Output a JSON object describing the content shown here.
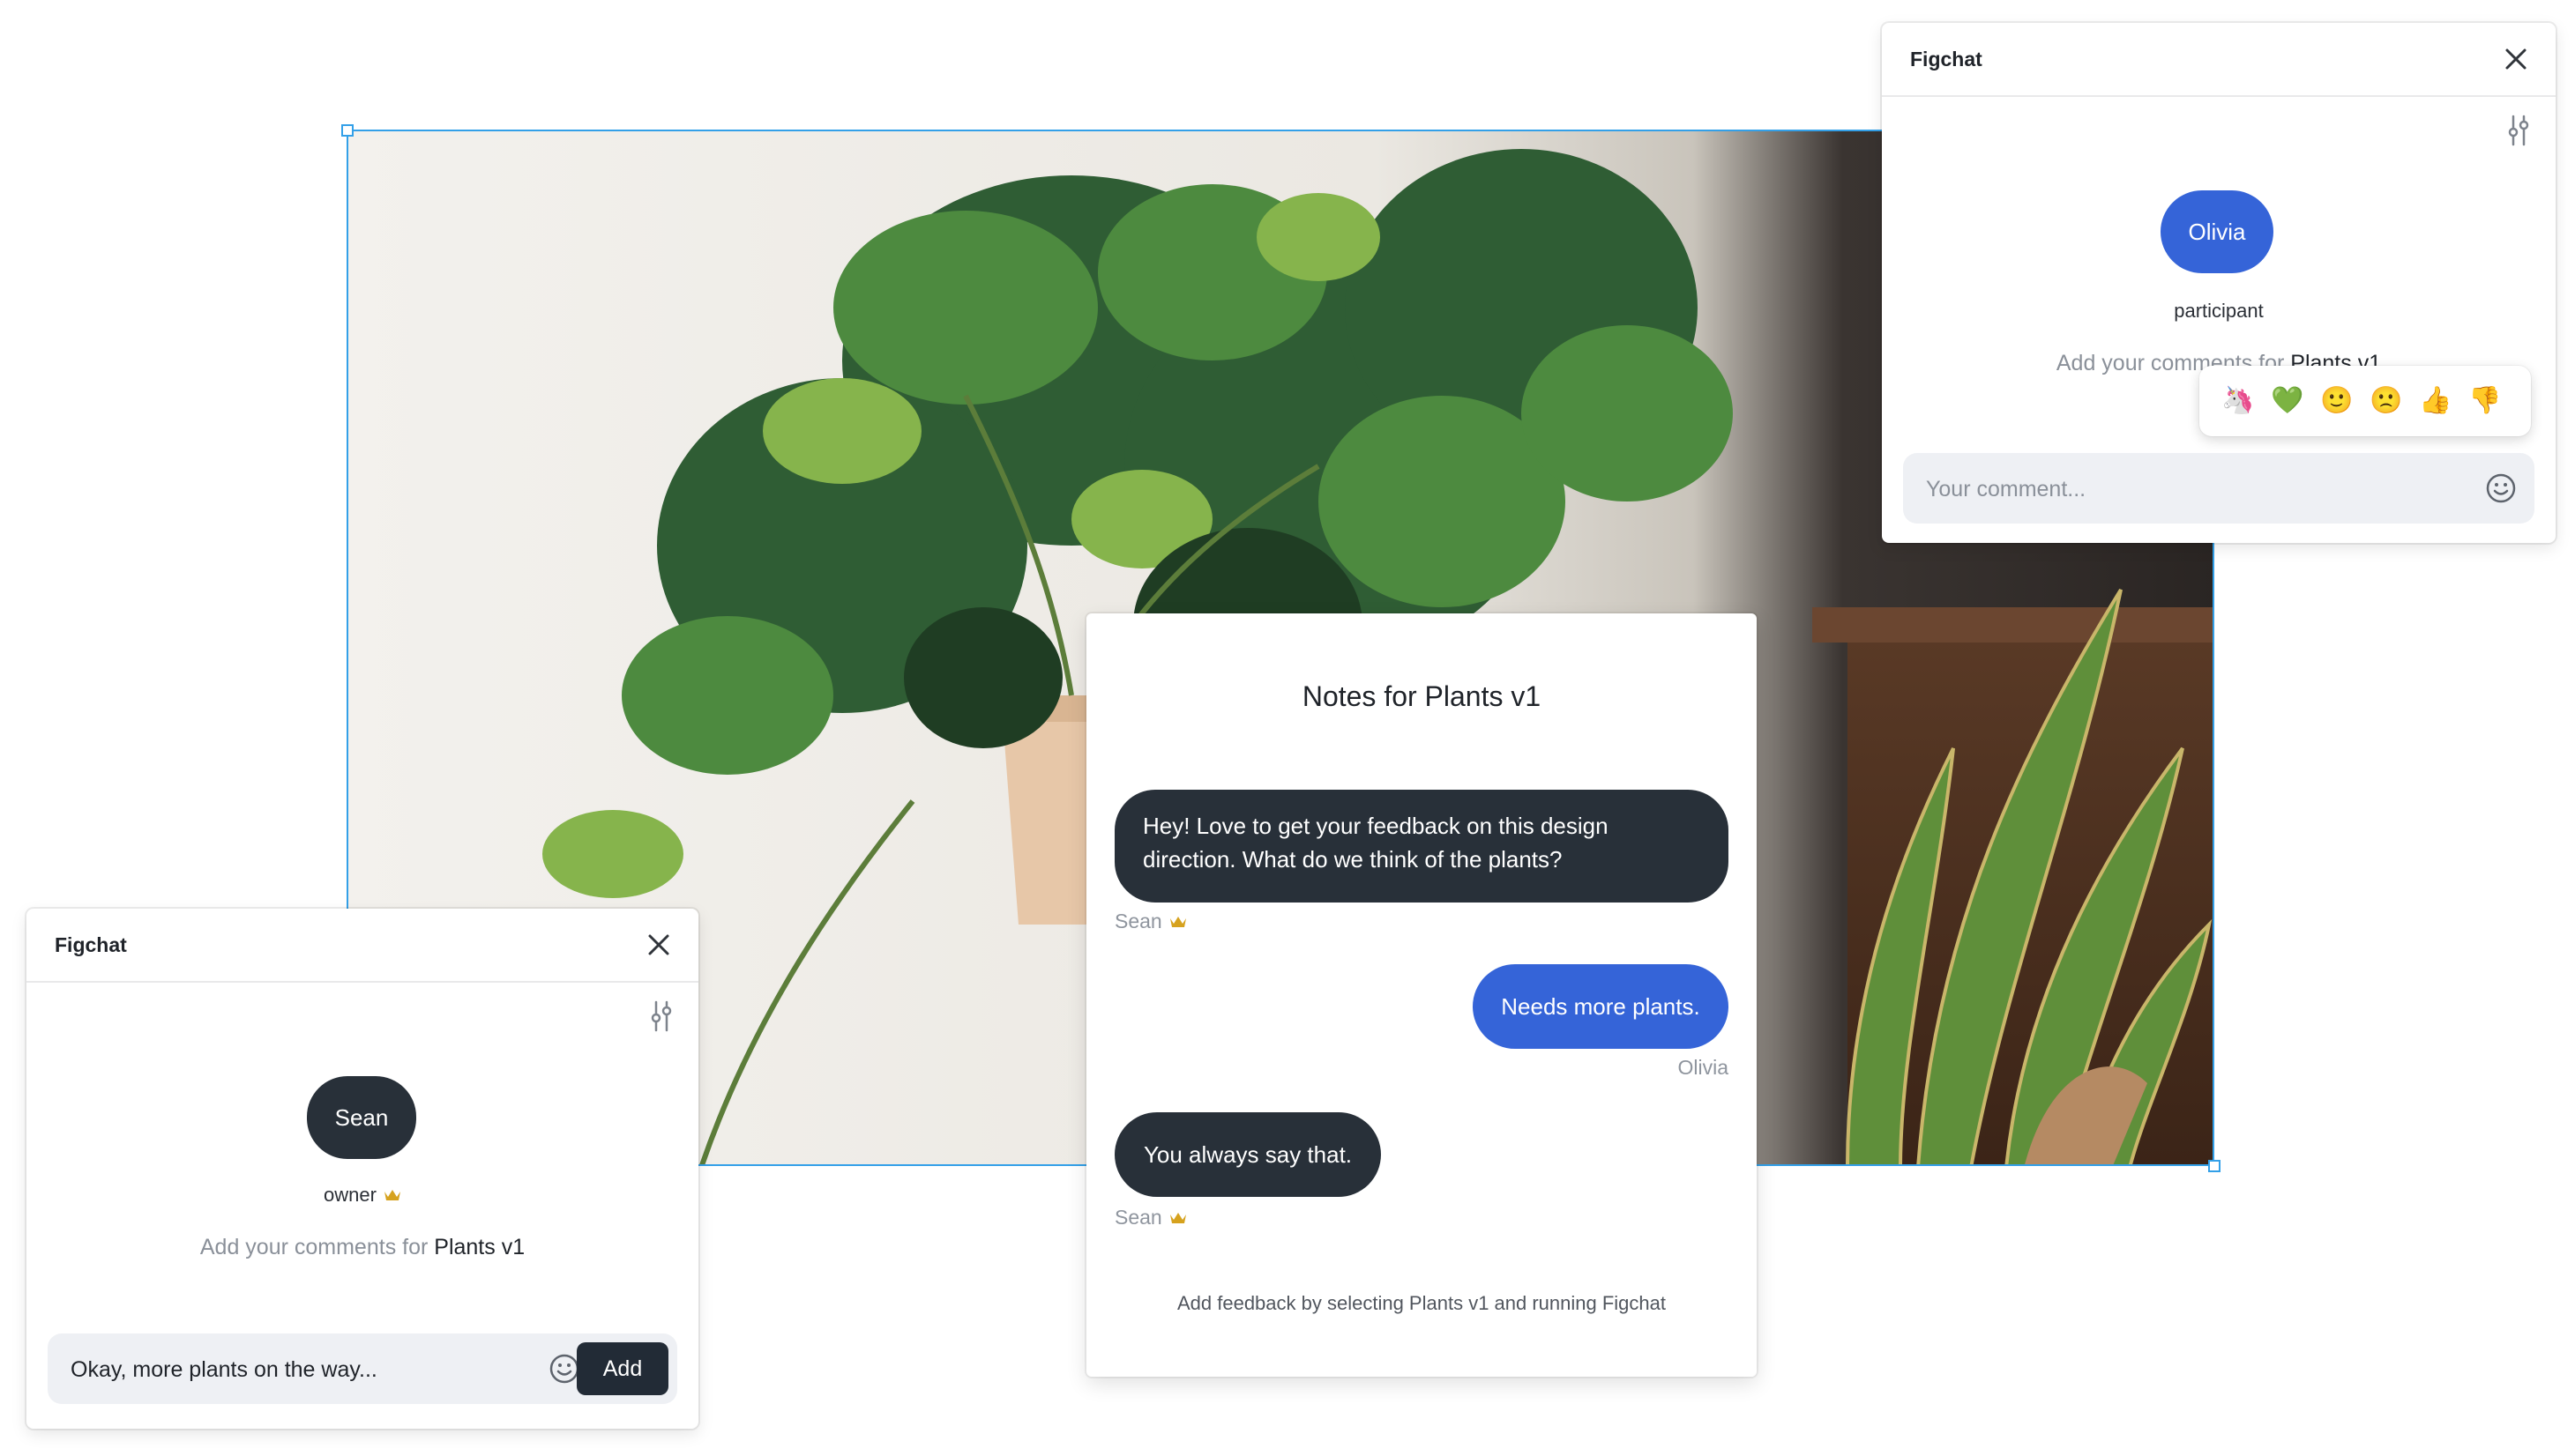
{
  "colors": {
    "selection": "#33a0e8",
    "dark_bubble": "#283039",
    "blue_bubble": "#3564d8",
    "add_button": "#222b36"
  },
  "top_right_window": {
    "title": "Figchat",
    "close_icon": "close-icon",
    "settings_icon": "sliders-icon",
    "avatar_name": "Olivia",
    "role": "participant",
    "hint_prefix": "Add your comments for",
    "hint_target": "Plants v1",
    "input_placeholder": "Your comment...",
    "emoji_icon": "smiley-icon"
  },
  "reactions": [
    "🦄",
    "💚",
    "🙂",
    "🙁",
    "👍",
    "👎"
  ],
  "bottom_left_window": {
    "title": "Figchat",
    "close_icon": "close-icon",
    "settings_icon": "sliders-icon",
    "avatar_name": "Sean",
    "role": "owner",
    "role_badge_icon": "crown-icon",
    "hint_prefix": "Add your comments for",
    "hint_target": "Plants v1",
    "input_value": "Okay, more plants on the way...",
    "emoji_icon": "smiley-icon",
    "add_label": "Add"
  },
  "notes": {
    "title": "Notes for Plants v1",
    "messages": [
      {
        "text_line1": "Hey! Love to get your feedback on this design",
        "text_line2": "direction. What do we think of the plants?",
        "author": "Sean"
      },
      {
        "text": "Needs more plants.",
        "author": "Olivia"
      },
      {
        "text": "You always say that.",
        "author": "Sean"
      }
    ],
    "footer": "Add feedback by selecting Plants v1 and running Figchat"
  }
}
